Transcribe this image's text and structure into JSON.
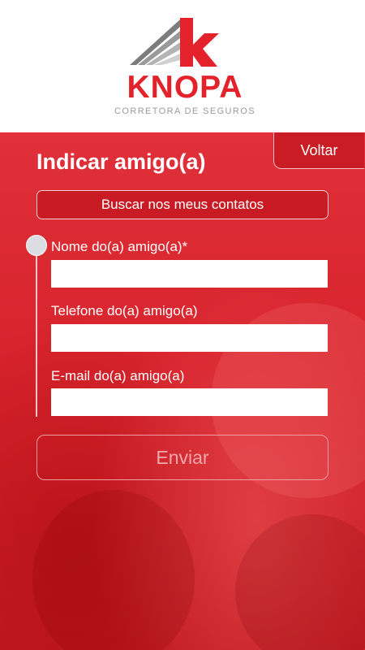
{
  "brand": {
    "name": "KNOPA",
    "tagline": "CORRETORA DE SEGUROS",
    "colors": {
      "red": "#e3222b",
      "gray": "#9a9a9a"
    }
  },
  "page": {
    "title": "Indicar amigo(a)",
    "back_label": "Voltar",
    "contacts_button_label": "Buscar nos meus contatos",
    "send_button_label": "Enviar"
  },
  "form": {
    "fields": [
      {
        "label": "Nome do(a) amigo(a)*",
        "value": ""
      },
      {
        "label": "Telefone do(a) amigo(a)",
        "value": ""
      },
      {
        "label": "E-mail do(a) amigo(a)",
        "value": ""
      }
    ]
  },
  "theme": {
    "primary": "#d7232c",
    "accent": "#c81b23",
    "text": "#ffffff"
  }
}
